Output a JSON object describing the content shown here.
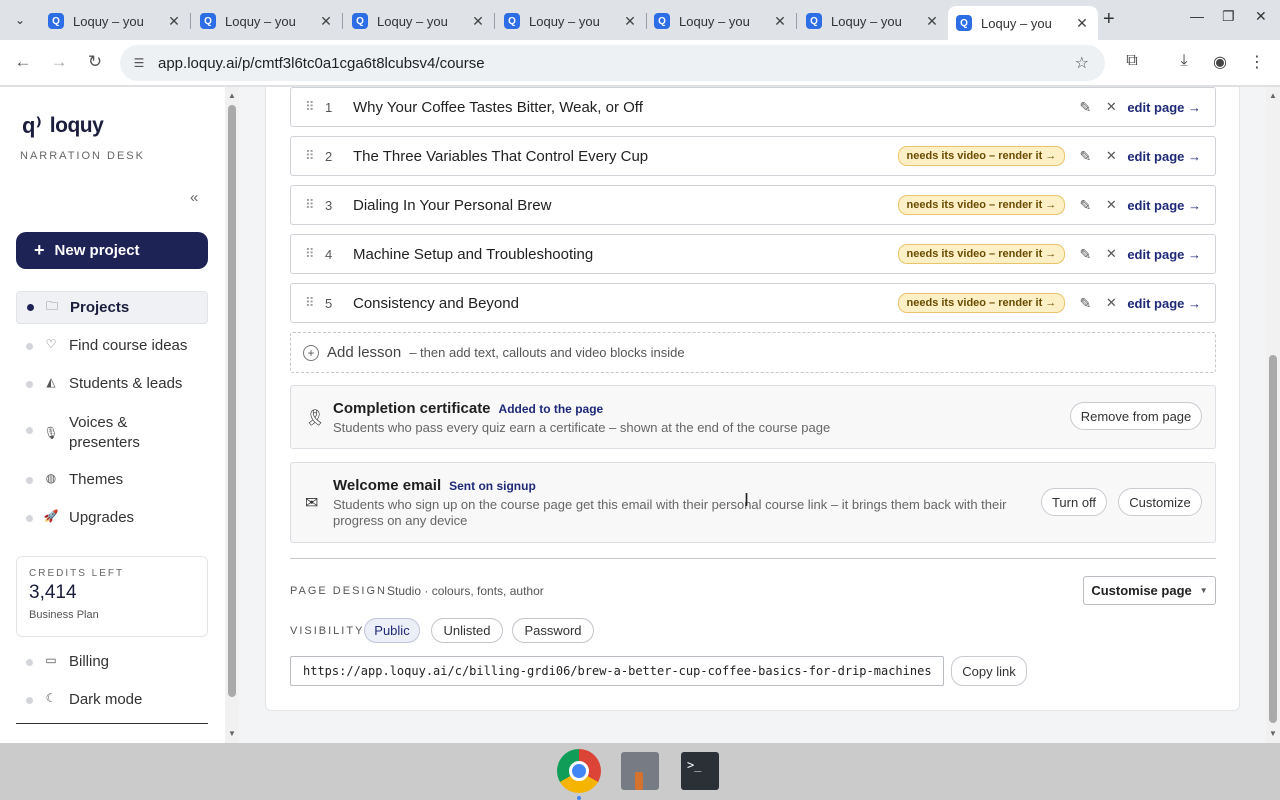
{
  "browser": {
    "tabs": [
      {
        "title": "Loquy – you"
      },
      {
        "title": "Loquy – you"
      },
      {
        "title": "Loquy – you"
      },
      {
        "title": "Loquy – you"
      },
      {
        "title": "Loquy – you"
      },
      {
        "title": "Loquy – you"
      },
      {
        "title": "Loquy – you"
      }
    ],
    "favicon_letter": "Q",
    "url": "app.loquy.ai/p/cmtf3l6tc0a1cga6t8lcubsv4/course"
  },
  "sidebar": {
    "brand": "loquy",
    "subtitle": "NARRATION DESK",
    "new_project": "New project",
    "items": [
      {
        "label": "Projects",
        "icon": "folder-icon",
        "active": true
      },
      {
        "label": "Find course ideas",
        "icon": "lightbulb-icon"
      },
      {
        "label": "Students & leads",
        "icon": "graduation-cap-icon"
      },
      {
        "label": "Voices & presenters",
        "icon": "microphone-icon"
      },
      {
        "label": "Themes",
        "icon": "palette-icon"
      },
      {
        "label": "Upgrades",
        "icon": "rocket-icon"
      }
    ],
    "credits": {
      "label": "CREDITS LEFT",
      "value": "3,414",
      "plan": "Business Plan"
    },
    "bottom_items": [
      {
        "label": "Billing",
        "icon": "card-icon"
      },
      {
        "label": "Dark mode",
        "icon": "moon-icon"
      }
    ]
  },
  "lessons": [
    {
      "num": "1",
      "title": "Why Your Coffee Tastes Bitter, Weak, or Off",
      "badge": "",
      "edit": "edit page →"
    },
    {
      "num": "2",
      "title": "The Three Variables That Control Every Cup",
      "badge": "needs its video – render it →",
      "edit": "edit page →"
    },
    {
      "num": "3",
      "title": "Dialing In Your Personal Brew",
      "badge": "needs its video – render it →",
      "edit": "edit page →"
    },
    {
      "num": "4",
      "title": "Machine Setup and Troubleshooting",
      "badge": "needs its video – render it →",
      "edit": "edit page →"
    },
    {
      "num": "5",
      "title": "Consistency and Beyond",
      "badge": "needs its video – render it →",
      "edit": "edit page →"
    }
  ],
  "add_lesson": {
    "label": "Add lesson",
    "hint": "– then add text, callouts and video blocks inside"
  },
  "certificate": {
    "title": "Completion certificate",
    "tag": "Added to the page",
    "desc": "Students who pass every quiz earn a certificate – shown at the end of the course page",
    "button": "Remove from page"
  },
  "welcome_email": {
    "title": "Welcome email",
    "tag": "Sent on signup",
    "desc_line1": "Students who sign up on the course page get this email with their personal course link – it brings them back with their",
    "desc_line2": "progress on any device",
    "turn_off": "Turn off",
    "customize": "Customize"
  },
  "page_design": {
    "label": "PAGE DESIGN",
    "desc": "Studio · colours, fonts, author",
    "button": "Customise page"
  },
  "visibility": {
    "label": "VISIBILITY",
    "options": [
      "Public",
      "Unlisted",
      "Password"
    ],
    "selected": "Public"
  },
  "share": {
    "url": "https://app.loquy.ai/c/billing-grdi06/brew-a-better-cup-coffee-basics-for-drip-machines",
    "copy": "Copy link"
  }
}
